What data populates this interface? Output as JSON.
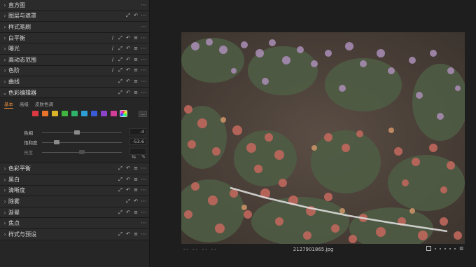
{
  "panel": {
    "tools_top": [
      {
        "label": "直方图",
        "icons": [
          "more-icon"
        ]
      },
      {
        "label": "图层与遮罩",
        "icons": [
          "expand-icon",
          "undo-icon",
          "more-icon"
        ]
      },
      {
        "label": "样式笔刷",
        "icons": [
          "more-icon"
        ]
      },
      {
        "label": "白平衡",
        "icons": [
          "picker-icon",
          "expand-icon",
          "undo-icon",
          "list-icon",
          "more-icon"
        ]
      },
      {
        "label": "曝光",
        "icons": [
          "picker-icon",
          "expand-icon",
          "undo-icon",
          "list-icon",
          "more-icon"
        ]
      },
      {
        "label": "高动态范围",
        "icons": [
          "picker-icon",
          "expand-icon",
          "undo-icon",
          "list-icon",
          "more-icon"
        ]
      },
      {
        "label": "色阶",
        "icons": [
          "picker-icon",
          "expand-icon",
          "undo-icon",
          "list-icon",
          "more-icon"
        ]
      },
      {
        "label": "曲线",
        "icons": [
          "expand-icon",
          "undo-icon",
          "list-icon",
          "more-icon"
        ]
      },
      {
        "label": "色彩编辑器",
        "icons": [
          "expand-icon",
          "undo-icon",
          "list-icon",
          "more-icon"
        ]
      }
    ],
    "color_editor": {
      "tabs": [
        "基本",
        "高级",
        "皮肤色调"
      ],
      "active_tab": "基本",
      "swatch_colors": [
        "#d9393f",
        "#e8742c",
        "#d9b32a",
        "#41b43f",
        "#2fb36a",
        "#2e9fd4",
        "#3b5bd6",
        "#8a43c9",
        "#d43c9a"
      ],
      "more_label": "...",
      "sliders": [
        {
          "label": "色相",
          "value": "-4",
          "level": 0.44,
          "enabled": true
        },
        {
          "label": "饱和度",
          "value": "-53.6",
          "level": 0.18,
          "enabled": true
        },
        {
          "label": "亮度",
          "value": "",
          "level": 0.5,
          "enabled": false
        }
      ]
    },
    "tools_bottom": [
      {
        "label": "色彩平衡",
        "icons": [
          "expand-icon",
          "undo-icon",
          "list-icon",
          "more-icon"
        ]
      },
      {
        "label": "黑白",
        "icons": [
          "expand-icon",
          "undo-icon",
          "list-icon",
          "more-icon"
        ]
      },
      {
        "label": "清晰度",
        "icons": [
          "expand-icon",
          "undo-icon",
          "list-icon",
          "more-icon"
        ]
      },
      {
        "label": "除雾",
        "icons": [
          "expand-icon",
          "undo-icon",
          "more-icon"
        ]
      },
      {
        "label": "渐晕",
        "icons": [
          "expand-icon",
          "undo-icon",
          "list-icon",
          "more-icon"
        ]
      },
      {
        "label": "焦点",
        "icons": [
          "more-icon"
        ]
      },
      {
        "label": "样式与预设",
        "icons": [
          "expand-icon",
          "undo-icon",
          "list-icon",
          "more-icon"
        ]
      }
    ]
  },
  "viewer": {
    "filename": "2127901865.jpg",
    "left_status": "--  --  --  --",
    "image_description_icon": "flower-photo"
  }
}
